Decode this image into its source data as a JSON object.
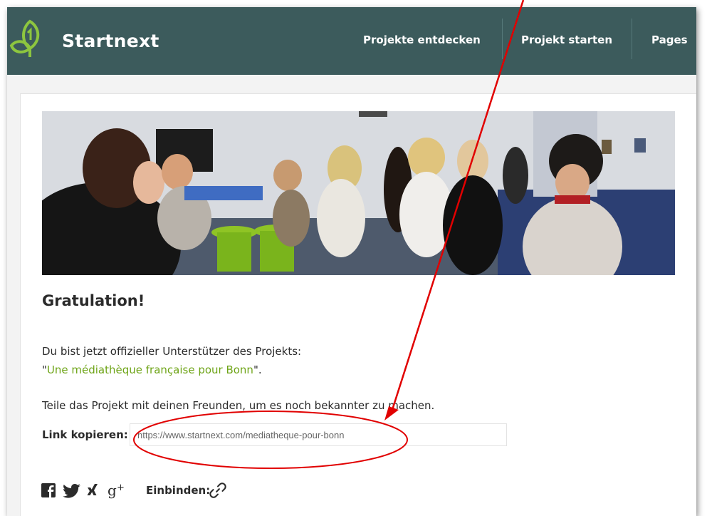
{
  "header": {
    "brand": "Startnext",
    "nav": [
      {
        "label": "Projekte entdecken"
      },
      {
        "label": "Projekt starten"
      },
      {
        "label": "Pages"
      }
    ]
  },
  "content": {
    "title": "Gratulation!",
    "supporter_line": "Du bist jetzt offizieller Unterstützer des Projekts:",
    "project_quote_open": "\"",
    "project_name": "Une médiathèque française pour Bonn",
    "project_quote_close": "\".",
    "share_text": "Teile das Projekt mit deinen Freunden, um es noch bekannter zu machen.",
    "link_label": "Link kopieren:",
    "link_value": "https://www.startnext.com/mediatheque-pour-bonn",
    "embed_label": "Einbinden:"
  },
  "share_icons": [
    "facebook-icon",
    "twitter-icon",
    "xing-icon",
    "google-plus-icon",
    "link-icon"
  ],
  "colors": {
    "header_bg": "#3c5b5c",
    "accent_green": "#6ea417",
    "annotation_red": "#e10000"
  }
}
